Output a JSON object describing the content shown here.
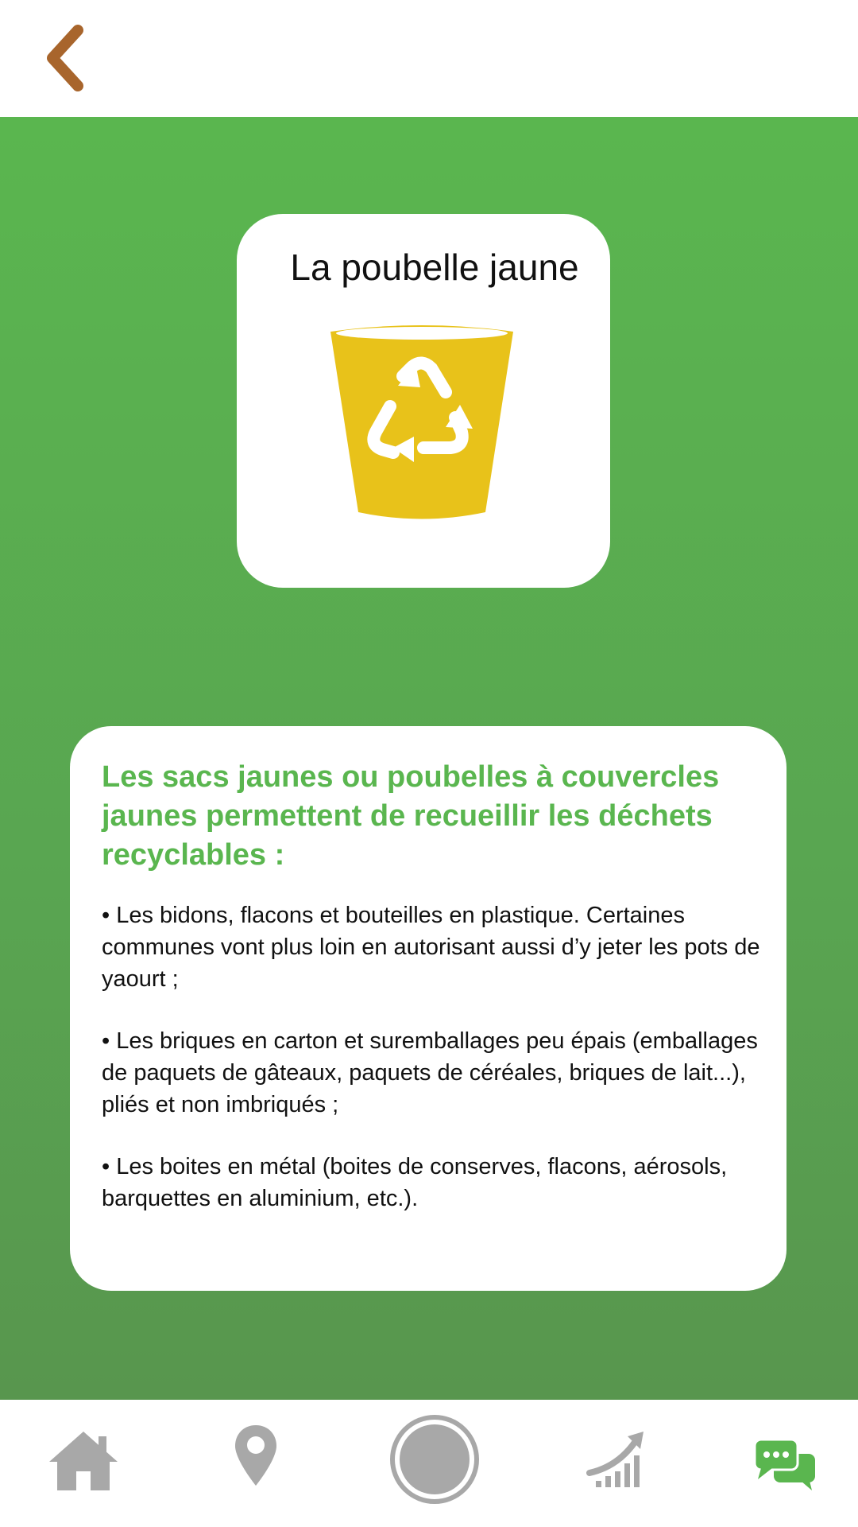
{
  "header": {
    "back_icon": "chevron-left-icon",
    "back_color": "#a8652c"
  },
  "bin_card": {
    "title": "La poubelle jaune",
    "icon": "yellow-recycling-bin-icon",
    "bin_color": "#e8c21a"
  },
  "info": {
    "heading": "Les sacs jaunes ou poubelles à couvercles jaunes permettent de recueillir les déchets recyclables :",
    "items": [
      "• Les bidons, flacons et bouteilles en plastique. Certaines communes vont plus loin en autorisant aussi d’y jeter les pots de yaourt ;",
      "• Les briques en carton et suremballages peu épais (emballages de paquets de gâteaux, paquets de céréales, briques de lait...), pliés et non imbriqués ;",
      "• Les boites en métal (boites de conserves, flacons, aérosols, barquettes en aluminium, etc.)."
    ]
  },
  "nav": {
    "items": [
      {
        "icon": "home-icon",
        "active": false
      },
      {
        "icon": "map-pin-icon",
        "active": false
      },
      {
        "icon": "record-button-icon",
        "active": false
      },
      {
        "icon": "growth-chart-icon",
        "active": false
      },
      {
        "icon": "chat-bubbles-icon",
        "active": true
      }
    ],
    "inactive_color": "#a8a8a8",
    "active_color": "#5ab64f"
  },
  "colors": {
    "brand_green": "#5ab64f",
    "text": "#111111"
  }
}
